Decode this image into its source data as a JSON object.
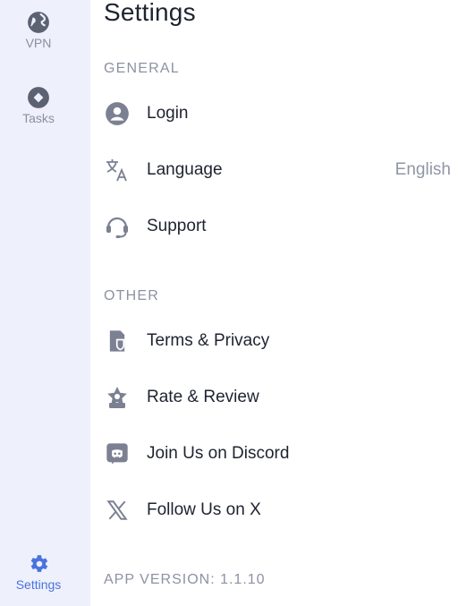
{
  "sidebar": {
    "items": [
      {
        "label": "VPN",
        "icon": "globe-icon"
      },
      {
        "label": "Tasks",
        "icon": "tasks-icon"
      },
      {
        "label": "Settings",
        "icon": "gear-icon",
        "active": true
      }
    ]
  },
  "page": {
    "title": "Settings"
  },
  "general": {
    "header": "GENERAL",
    "login_label": "Login",
    "language_label": "Language",
    "language_value": "English",
    "support_label": "Support"
  },
  "other": {
    "header": "OTHER",
    "terms_label": "Terms & Privacy",
    "rate_label": "Rate & Review",
    "discord_label": "Join Us on Discord",
    "x_label": "Follow Us on X"
  },
  "app_version": "APP VERSION: 1.1.10",
  "colors": {
    "sidebar_bg": "#eef0fb",
    "accent": "#4a72e0",
    "icon_gray": "#7b8092",
    "muted_text": "#8d92a3"
  }
}
